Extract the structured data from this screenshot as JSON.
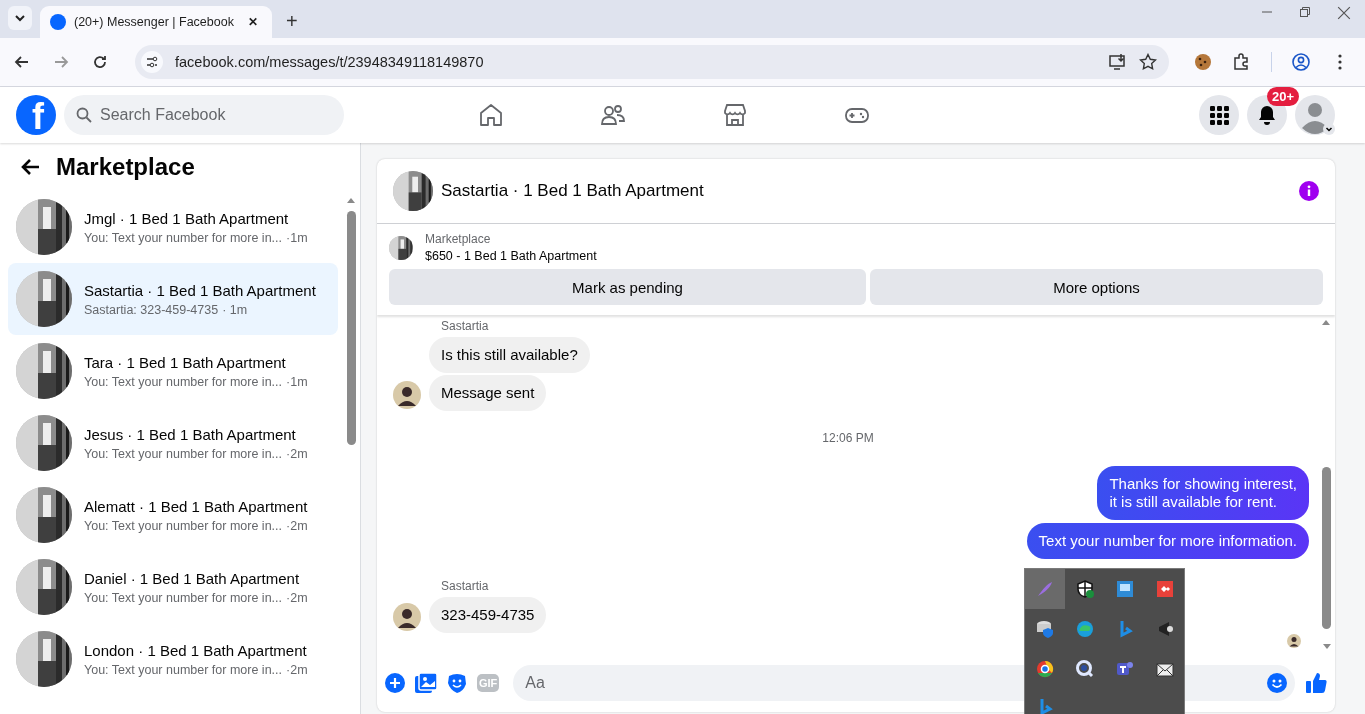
{
  "browser": {
    "tab": {
      "title": "(20+) Messenger | Facebook",
      "close": "✕",
      "selected": true
    },
    "new_tab": "+",
    "url": "facebook.com/messages/t/23948349118149870"
  },
  "topbar": {
    "logo": "f",
    "search": {
      "placeholder": "Search Facebook"
    },
    "notifications_badge": "20+"
  },
  "sidebar": {
    "title": "Marketplace",
    "conversations": [
      {
        "title": "Jmgl · 1 Bed 1 Bath Apartment",
        "preview": "You: Text your number for more in...",
        "time": "·1m",
        "selected": false
      },
      {
        "title": "Sastartia · 1 Bed 1 Bath Apartment",
        "preview": "Sastartia: 323-459-4735",
        "time": "· 1m",
        "selected": true
      },
      {
        "title": "Tara · 1 Bed 1 Bath Apartment",
        "preview": "You: Text your number for more in...",
        "time": "·1m",
        "selected": false
      },
      {
        "title": "Jesus · 1 Bed 1 Bath Apartment",
        "preview": "You: Text your number for more in...",
        "time": "·2m",
        "selected": false
      },
      {
        "title": "Alematt · 1 Bed 1 Bath Apartment",
        "preview": "You: Text your number for more in...",
        "time": "·2m",
        "selected": false
      },
      {
        "title": "Daniel · 1 Bed 1 Bath Apartment",
        "preview": "You: Text your number for more in...",
        "time": "·2m",
        "selected": false
      },
      {
        "title": "London · 1 Bed 1 Bath Apartment",
        "preview": "You: Text your number for more in...",
        "time": "·2m",
        "selected": false
      }
    ]
  },
  "chat": {
    "title": "Sastartia · 1 Bed 1 Bath Apartment",
    "listing": {
      "label": "Marketplace",
      "name": "$650 - 1 Bed 1 Bath Apartment"
    },
    "buttons": [
      "Mark as pending",
      "More options"
    ],
    "messages": [
      {
        "kind": "incoming",
        "sender": "Sastartia",
        "bubbles": [
          "Is this still available?",
          "Message sent"
        ]
      },
      {
        "kind": "timestamp",
        "text": "12:06 PM"
      },
      {
        "kind": "outgoing",
        "bubbles": [
          "Thanks for showing interest,\nit is still available for rent.",
          "Text your number for more information."
        ]
      },
      {
        "kind": "incoming",
        "sender": "Sastartia",
        "bubbles": [
          "323-459-4735"
        ]
      }
    ],
    "composer": {
      "gif": "GIF",
      "placeholder": "Aa"
    }
  }
}
